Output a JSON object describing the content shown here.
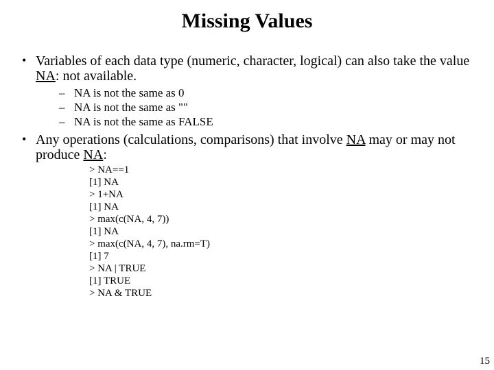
{
  "title": "Missing Values",
  "bullets": {
    "b1_pre": "Variables of each data type (numeric, character, logical) can also take the value ",
    "b1_na": "NA",
    "b1_post": ": not available.",
    "b1_sub": [
      "NA is not the same as 0",
      "NA is not the same as \"\"",
      "NA is not the same as FALSE"
    ],
    "b2_pre": "Any operations (calculations, comparisons) that involve ",
    "b2_na1": "NA",
    "b2_mid": " may or may not produce ",
    "b2_na2": "NA",
    "b2_post": ":"
  },
  "code": [
    "> NA==1",
    "[1] NA",
    "> 1+NA",
    "[1] NA",
    "> max(c(NA, 4, 7))",
    "[1] NA",
    "> max(c(NA, 4, 7), na.rm=T)",
    "[1] 7",
    "> NA | TRUE",
    "[1] TRUE",
    "> NA & TRUE"
  ],
  "page_number": "15"
}
